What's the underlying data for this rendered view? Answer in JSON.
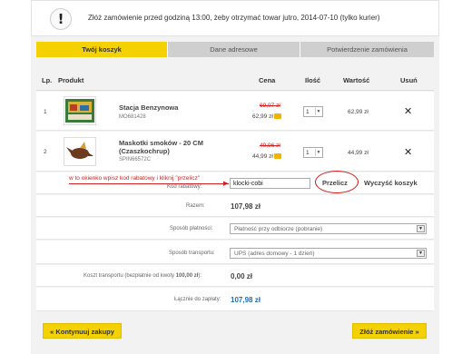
{
  "notice": {
    "icon": "exclamation-icon",
    "text": "Złóż zamówienie przed godziną 13:00, żeby otrzymać towar jutro, 2014-07-10 (tylko kurier)"
  },
  "steps": [
    {
      "label": "Twój koszyk",
      "active": true
    },
    {
      "label": "Dane adresowe",
      "active": false
    },
    {
      "label": "Potwierdzenie zamówienia",
      "active": false
    }
  ],
  "table": {
    "headers": {
      "lp": "Lp.",
      "product": "Produkt",
      "price": "Cena",
      "qty": "Ilość",
      "value": "Wartość",
      "remove": "Usuń"
    },
    "rows": [
      {
        "lp": "1",
        "name": "Stacja Benzynowa",
        "name2": "",
        "sku": "MO681428",
        "old_price": "69,97 zł",
        "price": "62,99 zł",
        "qty": "1",
        "value": "62,99 zł",
        "remove_icon": "close-icon"
      },
      {
        "lp": "2",
        "name": "Maskotki smoków - 20 CM",
        "name2": "(Czaszkochrup)",
        "sku": "SPIN66572C",
        "old_price": "49,96 zł",
        "price": "44,99 zł",
        "qty": "1",
        "value": "44,99 zł",
        "remove_icon": "close-icon"
      }
    ]
  },
  "coupon": {
    "annotation": "w to okienko wpisz kod rabatowy i kliknij \"przelicz\"",
    "label": "Kod rabatowy:",
    "value": "klocki-cobi",
    "recalc": "Przelicz",
    "clear": "Wyczyść koszyk"
  },
  "summary": {
    "total_label": "Razem:",
    "total_value": "107,98 zł",
    "payment_label": "Sposób płatności:",
    "payment_value": "Płatność przy odbiorze (pobranie)",
    "shipping_label": "Sposób transportu:",
    "shipping_value": "UPS (adres domowy - 1 dzień)",
    "transport_cost_label_pre": "Koszt transportu (bezpłatnie od kwoty ",
    "transport_cost_label_bold": "100,00 zł",
    "transport_cost_label_post": "):",
    "transport_cost_value": "0,00 zł",
    "grand_total_label": "Łącznie do zapłaty:",
    "grand_total_value": "107,98 zł"
  },
  "actions": {
    "continue": "« Kontynuuj zakupy",
    "order": "Złóż zamówienie »"
  },
  "colors": {
    "accent": "#f4d100",
    "annotation": "#d21f1f",
    "link": "#1e6fb5"
  }
}
